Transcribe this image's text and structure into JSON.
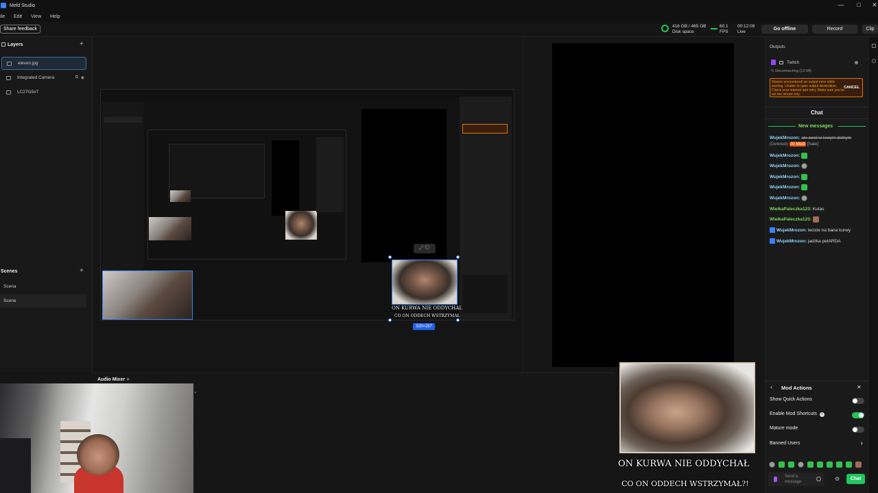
{
  "window": {
    "title": "Meld Studio",
    "controls": [
      "—",
      "□",
      "✕"
    ]
  },
  "menu": [
    "ile",
    "Edit",
    "View",
    "Help"
  ],
  "toolbar": {
    "share_feedback": "Share feedback",
    "disk": {
      "value": "416 GB / 465 GB",
      "label": "Disk space"
    },
    "fps": {
      "value": "60.1",
      "label": "FPS"
    },
    "live": {
      "value": "00:12:09",
      "label": "Live"
    },
    "go_offline": "Go offline",
    "record": "Record",
    "clip": "Clip"
  },
  "layers": {
    "title": "Layers",
    "add": "+",
    "items": [
      {
        "label": "eleven.jpg"
      },
      {
        "label": "Integrated Camera"
      },
      {
        "label": "LC27G5xT"
      }
    ]
  },
  "scenes": {
    "title": "Scenes",
    "add": "+",
    "items": [
      {
        "label": "Scena"
      },
      {
        "label": "Scene"
      }
    ]
  },
  "audio_mixer": {
    "title": "Audio Mixer",
    "add": "+"
  },
  "canvas": {
    "selection_size": "320×287"
  },
  "caption": {
    "line1": "ON KURWA NIE ODDYCHAŁ",
    "line2": "CO ON ODDECH WSTRZYMAŁ?!"
  },
  "nested_caption": {
    "line1": "ON KURWA NIE ODDYCHAL",
    "line2": "CO ON ODDECH WSTRZYMAŁ"
  },
  "outputs": {
    "title": "Outputs",
    "twitch": "Twitch",
    "status": "Reconnecting (12:08)",
    "error": "Stream encountered an output error while starting. Unable to open output destination. Check your internet and retry. Make sure you've set the stream key.",
    "cancel": "CANCEL"
  },
  "chat": {
    "title": "Chat",
    "new_messages": "New messages",
    "messages": [
      {
        "user": "WujekMrozon:",
        "text": "ale cwel w lewym dolnym",
        "tags": [
          "(Deleted)",
          "AI Mod",
          "[hate]"
        ]
      },
      {
        "user": "WujekMrozon:",
        "emote": "green"
      },
      {
        "user": "WujekMrozon:",
        "emote": "round"
      },
      {
        "user": "WujekMrozon:",
        "emote": "green"
      },
      {
        "user": "WujekMrozon:",
        "emote": "green"
      },
      {
        "user": "WujekMrozon:",
        "emote": "round"
      },
      {
        "user": "WielkaPaleczka123:",
        "text": "Kutas"
      },
      {
        "user": "WielkaPaleczka123:",
        "emote": "face"
      },
      {
        "user": "WujekMrozon:",
        "text": "lecicie na bana kurwy"
      },
      {
        "user": "WujekMrozon:",
        "text": "jadzka petARDA"
      }
    ],
    "send_placeholder": "Send a message",
    "send_button": "Chat"
  },
  "mod_actions": {
    "title": "Mod Actions",
    "items": [
      {
        "label": "Show Quick Actions",
        "on": false
      },
      {
        "label": "Enable Mod Shortcuts",
        "on": true
      },
      {
        "label": "Mature mode",
        "on": false
      }
    ],
    "banned_users": "Banned Users"
  },
  "colors": {
    "accent": "#3b82f6",
    "success": "#22c55e",
    "warning": "#d97706",
    "chat_green": "#7ddc59"
  }
}
